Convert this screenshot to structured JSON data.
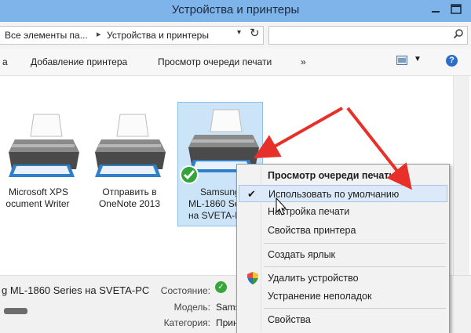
{
  "window": {
    "title": "Устройства и принтеры"
  },
  "address": {
    "crumb_root": "Все элементы па...",
    "crumb_current": "Устройства и принтеры",
    "search_placeholder": ""
  },
  "toolbar": {
    "stub": "а",
    "add_printer": "Добавление принтера",
    "print_queue": "Просмотр очереди печати",
    "more": "»"
  },
  "devices": [
    {
      "line1": "Microsoft XPS",
      "line2": "ocument Writer"
    },
    {
      "line1": "Отправить в",
      "line2": "OneNote 2013"
    },
    {
      "line1": "Samsung",
      "line2": "ML-1860 Se",
      "line3": "на SVETA-I"
    }
  ],
  "details": {
    "device_name": "g ML-1860 Series на SVETA-PC",
    "status_label": "Состояние:",
    "model_label": "Модель:",
    "model_value": "Sams",
    "category_label": "Категория:",
    "category_value": "Прин"
  },
  "context_menu": {
    "items": [
      {
        "label": "Просмотр очереди печати",
        "bold": true
      },
      {
        "label": "Использовать по умолчанию",
        "checked": true,
        "hover": true
      },
      {
        "label": "Настройка печати"
      },
      {
        "label": "Свойства принтера"
      },
      {
        "label": "Создать ярлык"
      },
      {
        "label": "Удалить устройство",
        "icon": "shield-icon"
      },
      {
        "label": "Устранение неполадок"
      },
      {
        "label": "Свойства"
      }
    ]
  },
  "colors": {
    "titlebar": "#7eb4ea",
    "selection": "#cce4f8",
    "arrow": "#e8302a",
    "menu_hover": "#dbe9f8"
  }
}
